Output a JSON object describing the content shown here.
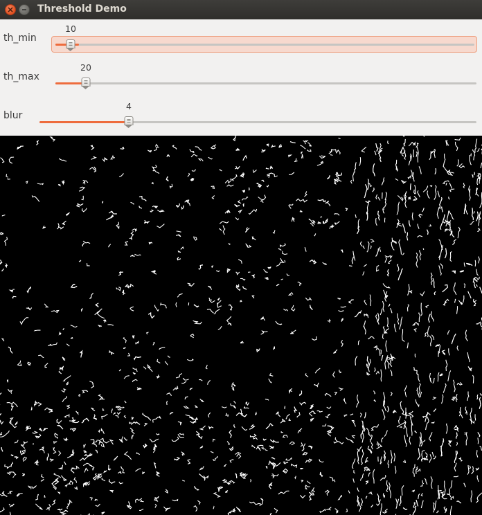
{
  "window": {
    "title": "Threshold Demo"
  },
  "sliders": [
    {
      "label": "th_min",
      "value": "10",
      "level": 0.057
    },
    {
      "label": "th_max",
      "value": "20",
      "level": 0.074
    },
    {
      "label": "blur",
      "value": "4",
      "level": 0.206
    }
  ],
  "colors": {
    "accent": "#ee6c3d",
    "panel": "#f2f1f0",
    "edges": "#ffffff",
    "background": "#000000"
  }
}
